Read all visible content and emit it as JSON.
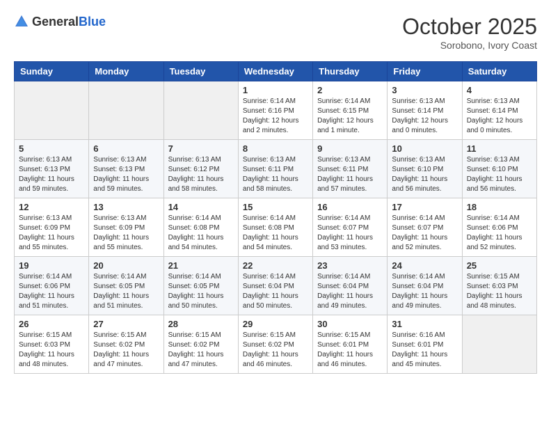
{
  "logo": {
    "general": "General",
    "blue": "Blue"
  },
  "title": "October 2025",
  "subtitle": "Sorobono, Ivory Coast",
  "days_of_week": [
    "Sunday",
    "Monday",
    "Tuesday",
    "Wednesday",
    "Thursday",
    "Friday",
    "Saturday"
  ],
  "weeks": [
    [
      {
        "day": "",
        "info": ""
      },
      {
        "day": "",
        "info": ""
      },
      {
        "day": "",
        "info": ""
      },
      {
        "day": "1",
        "info": "Sunrise: 6:14 AM\nSunset: 6:16 PM\nDaylight: 12 hours\nand 2 minutes."
      },
      {
        "day": "2",
        "info": "Sunrise: 6:14 AM\nSunset: 6:15 PM\nDaylight: 12 hours\nand 1 minute."
      },
      {
        "day": "3",
        "info": "Sunrise: 6:13 AM\nSunset: 6:14 PM\nDaylight: 12 hours\nand 0 minutes."
      },
      {
        "day": "4",
        "info": "Sunrise: 6:13 AM\nSunset: 6:14 PM\nDaylight: 12 hours\nand 0 minutes."
      }
    ],
    [
      {
        "day": "5",
        "info": "Sunrise: 6:13 AM\nSunset: 6:13 PM\nDaylight: 11 hours\nand 59 minutes."
      },
      {
        "day": "6",
        "info": "Sunrise: 6:13 AM\nSunset: 6:13 PM\nDaylight: 11 hours\nand 59 minutes."
      },
      {
        "day": "7",
        "info": "Sunrise: 6:13 AM\nSunset: 6:12 PM\nDaylight: 11 hours\nand 58 minutes."
      },
      {
        "day": "8",
        "info": "Sunrise: 6:13 AM\nSunset: 6:11 PM\nDaylight: 11 hours\nand 58 minutes."
      },
      {
        "day": "9",
        "info": "Sunrise: 6:13 AM\nSunset: 6:11 PM\nDaylight: 11 hours\nand 57 minutes."
      },
      {
        "day": "10",
        "info": "Sunrise: 6:13 AM\nSunset: 6:10 PM\nDaylight: 11 hours\nand 56 minutes."
      },
      {
        "day": "11",
        "info": "Sunrise: 6:13 AM\nSunset: 6:10 PM\nDaylight: 11 hours\nand 56 minutes."
      }
    ],
    [
      {
        "day": "12",
        "info": "Sunrise: 6:13 AM\nSunset: 6:09 PM\nDaylight: 11 hours\nand 55 minutes."
      },
      {
        "day": "13",
        "info": "Sunrise: 6:13 AM\nSunset: 6:09 PM\nDaylight: 11 hours\nand 55 minutes."
      },
      {
        "day": "14",
        "info": "Sunrise: 6:14 AM\nSunset: 6:08 PM\nDaylight: 11 hours\nand 54 minutes."
      },
      {
        "day": "15",
        "info": "Sunrise: 6:14 AM\nSunset: 6:08 PM\nDaylight: 11 hours\nand 54 minutes."
      },
      {
        "day": "16",
        "info": "Sunrise: 6:14 AM\nSunset: 6:07 PM\nDaylight: 11 hours\nand 53 minutes."
      },
      {
        "day": "17",
        "info": "Sunrise: 6:14 AM\nSunset: 6:07 PM\nDaylight: 11 hours\nand 52 minutes."
      },
      {
        "day": "18",
        "info": "Sunrise: 6:14 AM\nSunset: 6:06 PM\nDaylight: 11 hours\nand 52 minutes."
      }
    ],
    [
      {
        "day": "19",
        "info": "Sunrise: 6:14 AM\nSunset: 6:06 PM\nDaylight: 11 hours\nand 51 minutes."
      },
      {
        "day": "20",
        "info": "Sunrise: 6:14 AM\nSunset: 6:05 PM\nDaylight: 11 hours\nand 51 minutes."
      },
      {
        "day": "21",
        "info": "Sunrise: 6:14 AM\nSunset: 6:05 PM\nDaylight: 11 hours\nand 50 minutes."
      },
      {
        "day": "22",
        "info": "Sunrise: 6:14 AM\nSunset: 6:04 PM\nDaylight: 11 hours\nand 50 minutes."
      },
      {
        "day": "23",
        "info": "Sunrise: 6:14 AM\nSunset: 6:04 PM\nDaylight: 11 hours\nand 49 minutes."
      },
      {
        "day": "24",
        "info": "Sunrise: 6:14 AM\nSunset: 6:04 PM\nDaylight: 11 hours\nand 49 minutes."
      },
      {
        "day": "25",
        "info": "Sunrise: 6:15 AM\nSunset: 6:03 PM\nDaylight: 11 hours\nand 48 minutes."
      }
    ],
    [
      {
        "day": "26",
        "info": "Sunrise: 6:15 AM\nSunset: 6:03 PM\nDaylight: 11 hours\nand 48 minutes."
      },
      {
        "day": "27",
        "info": "Sunrise: 6:15 AM\nSunset: 6:02 PM\nDaylight: 11 hours\nand 47 minutes."
      },
      {
        "day": "28",
        "info": "Sunrise: 6:15 AM\nSunset: 6:02 PM\nDaylight: 11 hours\nand 47 minutes."
      },
      {
        "day": "29",
        "info": "Sunrise: 6:15 AM\nSunset: 6:02 PM\nDaylight: 11 hours\nand 46 minutes."
      },
      {
        "day": "30",
        "info": "Sunrise: 6:15 AM\nSunset: 6:01 PM\nDaylight: 11 hours\nand 46 minutes."
      },
      {
        "day": "31",
        "info": "Sunrise: 6:16 AM\nSunset: 6:01 PM\nDaylight: 11 hours\nand 45 minutes."
      },
      {
        "day": "",
        "info": ""
      }
    ]
  ]
}
